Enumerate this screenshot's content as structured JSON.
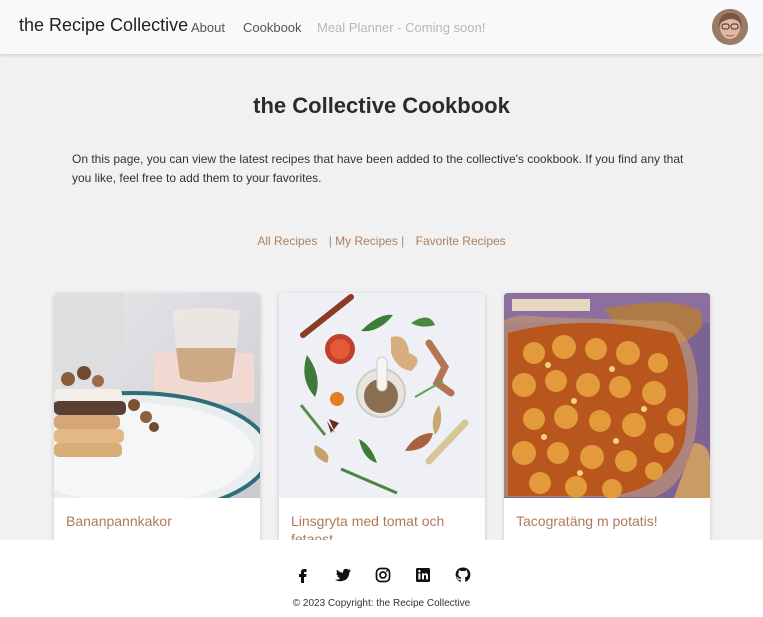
{
  "nav": {
    "brand": "the Recipe Collective",
    "links": [
      "About",
      "Cookbook",
      "Meal Planner - Coming soon!"
    ]
  },
  "main": {
    "title": "the Collective Cookbook",
    "intro": "On this page, you can view the latest recipes that have been added to the collective's cookbook. If you find any that you like, feel free to add them to your favorites.",
    "filters": [
      "All Recipes",
      "| My Recipes |",
      "Favorite Recipes"
    ]
  },
  "cards": [
    {
      "title": "Bananpannkakor"
    },
    {
      "title": "Linsgryta med tomat och fetaost"
    },
    {
      "title": "Tacogratäng m potatis!"
    }
  ],
  "footer": {
    "icons": [
      "facebook-icon",
      "twitter-icon",
      "instagram-icon",
      "linkedin-icon",
      "github-icon"
    ],
    "copyright_prefix": "© 2023 Copyright: ",
    "copyright_brand": "the Recipe Collective"
  },
  "colors": {
    "accent": "#b07a5a",
    "navbar": "#f8f9fa",
    "background": "#f1f1f1"
  }
}
